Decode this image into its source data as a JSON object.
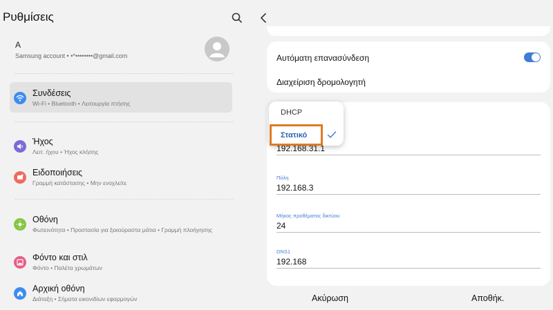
{
  "left": {
    "title": "Ρυθμίσεις",
    "account": {
      "name": "A",
      "subtitle": "Samsung account • •*••••••••@gmail.com"
    },
    "items": [
      {
        "label": "Συνδέσεις",
        "sub": "Wi-Fi • Bluetooth • Λειτουργία πτήσης",
        "color": "#3d8cf0",
        "icon": "wifi-icon"
      },
      {
        "label": "Ήχος",
        "sub": "Λειτ. ήχου • Ήχος κλήσης",
        "color": "#7b6bd8",
        "icon": "speaker-icon"
      },
      {
        "label": "Ειδοποιήσεις",
        "sub": "Γραμμή κατάστασης • Μην ενοχλείτε",
        "color": "#ef6b5f",
        "icon": "notification-icon"
      },
      {
        "label": "Οθόνη",
        "sub": "Φωτεινότητα • Προστασία για ξεκούραστα μάτια • Γραμμή πλοήγησης",
        "color": "#86c545",
        "icon": "sun-icon"
      },
      {
        "label": "Φόντο και στιλ",
        "sub": "Φόντο • Παλέτα χρωμάτων",
        "color": "#e85c86",
        "icon": "image-icon"
      },
      {
        "label": "Αρχική οθόνη",
        "sub": "Διάταξη • Σήματα εικονιδίων εφαρμογών",
        "color": "#3d8cf0",
        "icon": "home-icon"
      }
    ]
  },
  "right": {
    "auto_reconnect": "Αυτόματη επανασύνδεση",
    "auto_reconnect_on": true,
    "router_management": "Διαχείριση δρομολογητή",
    "ip_settings": {
      "options": [
        "DHCP",
        "Στατικό"
      ],
      "selected": "Στατικό"
    },
    "fields": {
      "ip_value": "192.168.31.1",
      "gateway_label": "Πύλη",
      "gateway_value": "192.168.3",
      "prefix_label": "Μήκος προθέματος δικτύου",
      "prefix_value": "24",
      "dns1_label": "DNS1",
      "dns1_value": "192.168"
    },
    "cancel": "Ακύρωση",
    "save": "Αποθήκ."
  },
  "colors": {
    "accent": "#3f7dd6",
    "highlight": "#e07a22"
  }
}
